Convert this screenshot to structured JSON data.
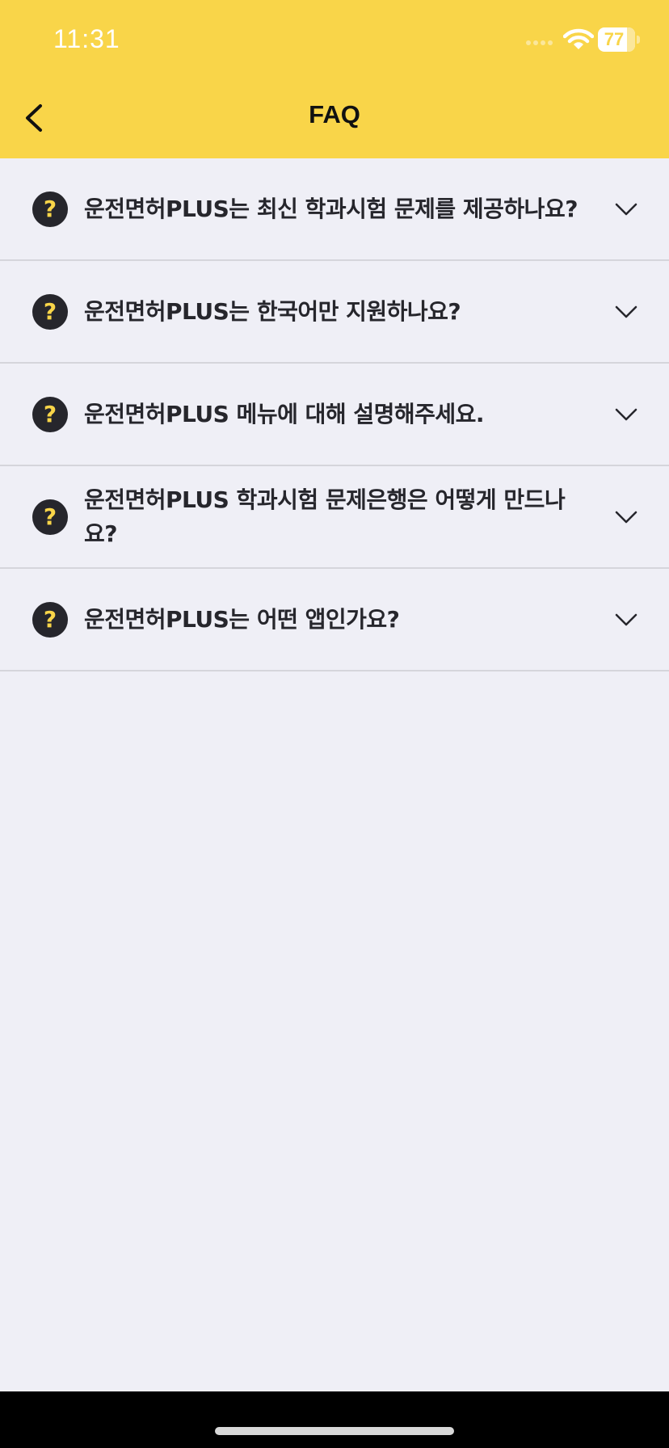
{
  "status_bar": {
    "time": "11:31",
    "battery_level": "77",
    "battery_fraction": 0.77
  },
  "header": {
    "title": "FAQ",
    "back_icon": "chevron-left-icon"
  },
  "faq": {
    "question_icon_glyph": "?",
    "items": [
      {
        "question": "운전면허PLUS는 최신 학과시험 문제를 제공하나요?"
      },
      {
        "question": "운전면허PLUS는 한국어만 지원하나요?"
      },
      {
        "question": "운전면허PLUS 메뉴에 대해 설명해주세요."
      },
      {
        "question": "운전면허PLUS 학과시험 문제은행은 어떻게 만드나요?"
      },
      {
        "question": "운전면허PLUS는 어떤 앱인가요?"
      }
    ]
  },
  "colors": {
    "header_background": "#f9d549",
    "page_background": "#efeff6",
    "text": "#26262c",
    "divider": "#d5d5db"
  }
}
